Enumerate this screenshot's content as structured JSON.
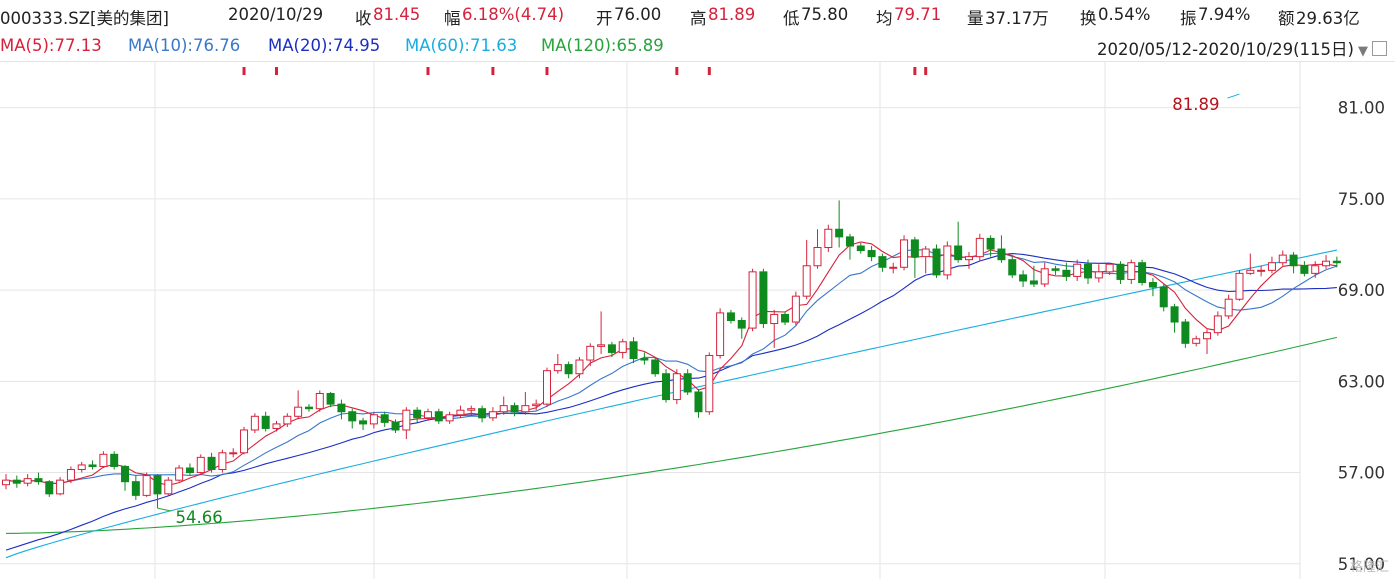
{
  "header": {
    "code": "000333.SZ[美的集团]",
    "date": "2020/10/29",
    "close_label": "收",
    "close": "81.45",
    "chg_label": "幅",
    "chg": "6.18%(4.74)",
    "open_label": "开",
    "open": "76.00",
    "high_label": "高",
    "high": "81.89",
    "low_label": "低",
    "low": "75.80",
    "avg_label": "均",
    "avg": "79.71",
    "vol_label": "量",
    "vol": "37.17万",
    "turn_label": "换",
    "turn": "0.54%",
    "amp_label": "振",
    "amp": "7.94%",
    "amt_label": "额",
    "amt": "29.63亿"
  },
  "ma_legend": [
    {
      "text": "MA(5):77.13",
      "color": "#d9203a"
    },
    {
      "text": "MA(10):76.76",
      "color": "#3a78c9"
    },
    {
      "text": "MA(20):74.95",
      "color": "#1c2ec2"
    },
    {
      "text": "MA(60):71.63",
      "color": "#16aee0"
    },
    {
      "text": "MA(120):65.89",
      "color": "#27a43c"
    }
  ],
  "range": {
    "label": "2020/05/12-2020/10/29(115日)",
    "dropdown_icon": "triangle-down-icon",
    "expand_icon": "square-icon"
  },
  "colors": {
    "up": "#d6223c",
    "down": "#0f8a1e",
    "grid": "#e6e6e6",
    "axis_text": "#333333"
  },
  "watermark": "格隆汇",
  "chart_data": {
    "type": "candlestick",
    "ylim": [
      50,
      84
    ],
    "yticks": [
      "81.00",
      "75.00",
      "69.00",
      "63.00",
      "57.00",
      "51.00"
    ],
    "ytick_values": [
      81,
      75,
      69,
      63,
      57,
      51
    ],
    "high_annotation": {
      "text": "81.89",
      "index": 114,
      "value": 81.89
    },
    "low_annotation": {
      "text": "54.66",
      "index": 14,
      "value": 54.66
    },
    "event_marker_indices": [
      22,
      25,
      39,
      45,
      50,
      62,
      65,
      84,
      85
    ],
    "candles": [
      [
        56.2,
        56.5,
        56.9,
        55.9
      ],
      [
        56.5,
        56.3,
        56.8,
        56.0
      ],
      [
        56.3,
        56.6,
        56.9,
        56.1
      ],
      [
        56.6,
        56.4,
        57.0,
        56.2
      ],
      [
        56.4,
        55.6,
        56.5,
        55.4
      ],
      [
        55.6,
        56.5,
        56.7,
        55.5
      ],
      [
        56.5,
        57.2,
        57.4,
        56.3
      ],
      [
        57.2,
        57.5,
        57.7,
        57.0
      ],
      [
        57.5,
        57.4,
        57.8,
        57.2
      ],
      [
        57.4,
        58.2,
        58.4,
        57.3
      ],
      [
        58.2,
        57.4,
        58.4,
        57.2
      ],
      [
        57.4,
        56.4,
        57.5,
        55.8
      ],
      [
        56.4,
        55.5,
        56.8,
        55.2
      ],
      [
        55.5,
        56.8,
        57.0,
        55.4
      ],
      [
        56.8,
        55.6,
        56.9,
        54.66
      ],
      [
        55.6,
        56.5,
        56.7,
        55.5
      ],
      [
        56.5,
        57.3,
        57.5,
        56.4
      ],
      [
        57.3,
        57.0,
        57.6,
        56.8
      ],
      [
        57.0,
        58.0,
        58.2,
        56.9
      ],
      [
        58.0,
        57.2,
        58.3,
        57.0
      ],
      [
        57.2,
        58.3,
        58.5,
        57.0
      ],
      [
        58.3,
        58.3,
        58.6,
        58.0
      ],
      [
        58.3,
        59.8,
        60.0,
        58.2
      ],
      [
        59.8,
        60.7,
        60.9,
        59.6
      ],
      [
        60.7,
        59.9,
        61.0,
        59.7
      ],
      [
        59.9,
        60.2,
        60.4,
        59.7
      ],
      [
        60.2,
        60.7,
        60.9,
        60.0
      ],
      [
        60.7,
        61.3,
        62.4,
        60.5
      ],
      [
        61.3,
        61.2,
        61.5,
        61.0
      ],
      [
        61.2,
        62.2,
        62.4,
        61.0
      ],
      [
        62.2,
        61.5,
        62.3,
        61.3
      ],
      [
        61.5,
        61.0,
        61.8,
        60.5
      ],
      [
        61.0,
        60.4,
        61.2,
        59.9
      ],
      [
        60.4,
        60.2,
        60.6,
        59.8
      ],
      [
        60.2,
        60.8,
        61.0,
        59.9
      ],
      [
        60.8,
        60.3,
        61.0,
        60.0
      ],
      [
        60.3,
        59.8,
        60.5,
        59.6
      ],
      [
        59.8,
        61.1,
        61.3,
        59.2
      ],
      [
        61.1,
        60.6,
        61.3,
        60.3
      ],
      [
        60.6,
        61.0,
        61.2,
        60.4
      ],
      [
        61.0,
        60.4,
        61.2,
        60.2
      ],
      [
        60.4,
        60.8,
        61.0,
        60.2
      ],
      [
        60.8,
        61.1,
        61.4,
        60.6
      ],
      [
        61.1,
        61.2,
        61.4,
        60.8
      ],
      [
        61.2,
        60.6,
        61.4,
        60.3
      ],
      [
        60.6,
        61.0,
        61.3,
        60.4
      ],
      [
        61.0,
        61.4,
        62.0,
        60.8
      ],
      [
        61.4,
        61.0,
        61.6,
        60.7
      ],
      [
        61.0,
        61.4,
        62.3,
        60.8
      ],
      [
        61.4,
        61.5,
        61.8,
        61.1
      ],
      [
        61.5,
        63.7,
        63.9,
        61.3
      ],
      [
        63.7,
        64.1,
        64.8,
        63.5
      ],
      [
        64.1,
        63.5,
        64.3,
        63.2
      ],
      [
        63.5,
        64.4,
        64.6,
        63.2
      ],
      [
        64.4,
        65.3,
        65.5,
        64.0
      ],
      [
        65.3,
        65.4,
        67.6,
        64.8
      ],
      [
        65.4,
        64.9,
        65.6,
        64.6
      ],
      [
        64.9,
        65.6,
        65.8,
        64.5
      ],
      [
        65.6,
        64.5,
        65.9,
        64.2
      ],
      [
        64.5,
        64.4,
        64.9,
        64.1
      ],
      [
        64.4,
        63.5,
        64.6,
        63.3
      ],
      [
        63.5,
        61.8,
        63.8,
        61.6
      ],
      [
        61.8,
        63.5,
        63.8,
        61.5
      ],
      [
        63.5,
        62.3,
        63.8,
        62.1
      ],
      [
        62.3,
        61.0,
        62.5,
        60.6
      ],
      [
        61.0,
        64.7,
        64.9,
        60.8
      ],
      [
        64.7,
        67.5,
        67.8,
        64.5
      ],
      [
        67.5,
        67.0,
        67.7,
        66.8
      ],
      [
        67.0,
        66.5,
        67.2,
        65.8
      ],
      [
        66.5,
        70.2,
        70.4,
        66.3
      ],
      [
        70.2,
        66.8,
        70.4,
        66.5
      ],
      [
        66.8,
        67.4,
        67.7,
        65.2
      ],
      [
        67.4,
        66.9,
        67.6,
        66.7
      ],
      [
        66.9,
        68.6,
        68.9,
        66.7
      ],
      [
        68.6,
        70.6,
        72.3,
        68.4
      ],
      [
        70.6,
        71.8,
        73.0,
        70.4
      ],
      [
        71.8,
        73.0,
        73.3,
        71.5
      ],
      [
        73.0,
        72.5,
        74.9,
        71.8
      ],
      [
        72.5,
        71.9,
        72.7,
        71.0
      ],
      [
        71.9,
        71.6,
        72.1,
        71.4
      ],
      [
        71.6,
        71.2,
        71.9,
        70.9
      ],
      [
        71.2,
        70.5,
        71.4,
        70.2
      ],
      [
        70.5,
        70.5,
        70.8,
        70.1
      ],
      [
        70.5,
        72.3,
        72.6,
        70.3
      ],
      [
        72.3,
        71.2,
        72.5,
        69.8
      ],
      [
        71.2,
        71.7,
        71.9,
        70.1
      ],
      [
        71.7,
        70.0,
        72.0,
        69.8
      ],
      [
        70.0,
        71.9,
        72.2,
        69.7
      ],
      [
        71.9,
        71.0,
        73.5,
        70.8
      ],
      [
        71.0,
        71.2,
        71.5,
        70.4
      ],
      [
        71.2,
        72.4,
        72.7,
        70.9
      ],
      [
        72.4,
        71.7,
        72.6,
        71.2
      ],
      [
        71.7,
        71.0,
        72.6,
        70.8
      ],
      [
        71.0,
        70.0,
        71.2,
        69.8
      ],
      [
        70.0,
        69.6,
        70.3,
        69.2
      ],
      [
        69.6,
        69.4,
        70.6,
        69.2
      ],
      [
        69.4,
        70.4,
        70.8,
        69.2
      ],
      [
        70.4,
        70.3,
        70.6,
        70.0
      ],
      [
        70.3,
        69.9,
        70.8,
        69.6
      ],
      [
        69.9,
        70.7,
        71.0,
        69.6
      ],
      [
        70.7,
        69.8,
        71.0,
        69.4
      ],
      [
        69.8,
        70.2,
        70.7,
        69.5
      ],
      [
        70.2,
        70.7,
        70.8,
        70.0
      ],
      [
        70.7,
        69.7,
        70.9,
        69.4
      ],
      [
        69.7,
        70.8,
        71.0,
        69.4
      ],
      [
        70.8,
        69.5,
        71.0,
        69.3
      ],
      [
        69.5,
        69.2,
        69.8,
        68.6
      ],
      [
        69.2,
        67.9,
        69.4,
        67.6
      ],
      [
        67.9,
        66.9,
        68.1,
        66.2
      ],
      [
        66.9,
        65.5,
        67.1,
        65.2
      ],
      [
        65.5,
        65.8,
        66.0,
        65.3
      ],
      [
        65.8,
        66.2,
        66.4,
        64.8
      ],
      [
        66.2,
        67.3,
        67.6,
        66.0
      ],
      [
        67.3,
        68.4,
        68.7,
        67.1
      ],
      [
        68.4,
        70.1,
        70.3,
        68.3
      ],
      [
        70.1,
        70.3,
        71.4,
        70.0
      ],
      [
        70.3,
        70.3,
        70.6,
        69.9
      ],
      [
        70.3,
        70.8,
        71.2,
        70.1
      ],
      [
        70.8,
        71.3,
        71.6,
        70.6
      ],
      [
        71.3,
        70.6,
        71.5,
        70.1
      ],
      [
        70.6,
        70.1,
        70.9,
        69.9
      ],
      [
        70.1,
        70.6,
        70.9,
        69.8
      ],
      [
        70.6,
        70.9,
        71.3,
        70.4
      ],
      [
        70.9,
        70.8,
        71.2,
        70.5
      ]
    ]
  }
}
